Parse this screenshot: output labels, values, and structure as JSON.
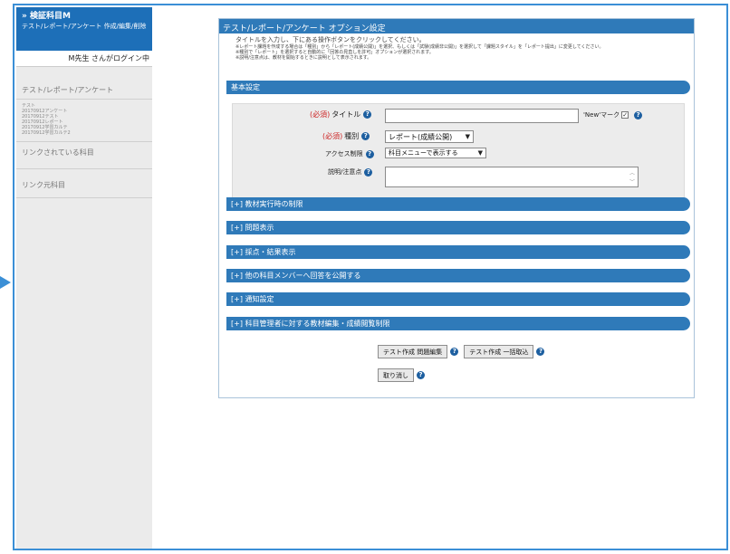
{
  "sidebar": {
    "course_title": "» 検証科目M",
    "course_sub": "テスト/レポート/アンケート 作成/編集/削除",
    "login_text": "M先生 さんがログイン中",
    "section_tests": "テスト/レポート/アンケート",
    "test_items": [
      "テスト",
      "20170912アンケート",
      "20170912テスト",
      "20170912レポート",
      "20170912学習カルテ",
      "20170912学習カルテ2"
    ],
    "section_linked": "リンクされている科目",
    "section_linksrc": "リンク元科目"
  },
  "panel": {
    "header": "テスト/レポート/アンケート オプション設定",
    "desc_main": "タイトルを入力し、下にある操作ボタンをクリックしてください。",
    "desc_notes": [
      "※レポート課題を作成する場合は「種別」から「レポート(成績公開)」を選択、もしくは「試験(成績非公開)」を選択して「課題スタイル」を「レポート提出」に変更してください。",
      "※種別で「レポート」を選択すると自動的に「回答の見直しを許可」オプションが選択されます。",
      "※説明/注意点は、教材を開始するときに説明として表示されます。"
    ]
  },
  "basic": {
    "section_label": "基本設定",
    "required_label": "(必須)",
    "title_label": "タイトル",
    "title_value": "",
    "new_mark_label": "'New'マーク",
    "new_mark_checked": true,
    "type_label": "種別",
    "type_value": "レポート(成績公開)",
    "access_label": "アクセス制限",
    "access_value": "科目メニューで表示する",
    "notes_label": "説明/注意点",
    "notes_value": ""
  },
  "sections": [
    "[+] 教材実行時の制限",
    "[+] 問題表示",
    "[+] 採点・結果表示",
    "[+] 他の科目メンバーへ回答を公開する",
    "[+] 通知設定",
    "[+] 科目管理者に対する教材編集・成績閲覧制限"
  ],
  "buttons": {
    "edit_questions": "テスト作成 問題編集",
    "bulk_import": "テスト作成 一括取込",
    "cancel": "取り消し"
  },
  "icons": {
    "help": "?",
    "check": "✓",
    "dropdown": "▼"
  },
  "colors": {
    "accent": "#2f7ab9",
    "required": "#cc2222"
  }
}
